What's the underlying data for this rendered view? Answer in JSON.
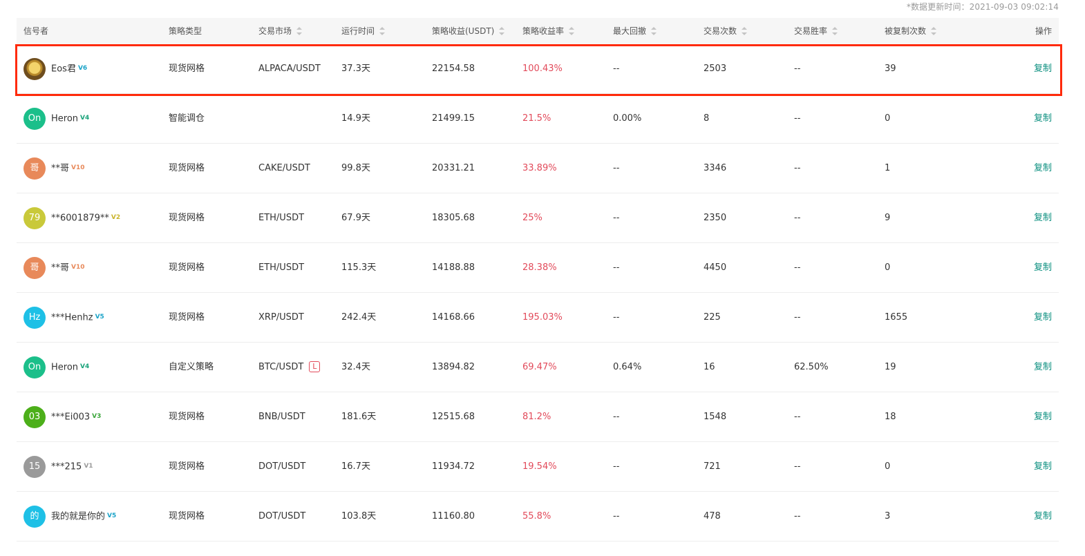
{
  "update_time": "*数据更新时间：2021-09-03 09:02:14",
  "columns": [
    "信号者",
    "策略类型",
    "交易市场",
    "运行时间",
    "策略收益(USDT)",
    "策略收益率",
    "最大回撤",
    "交易次数",
    "交易胜率",
    "被复制次数",
    "操作"
  ],
  "colors": {
    "return": "#e24a5a",
    "copy": "#0b8f7f",
    "highlight": "#ff2a0a"
  },
  "rows": [
    {
      "avatar": "",
      "avatar_color": "#b98a2a",
      "name": "Eos君",
      "badge": "V6",
      "badge_color": "#1aa3c8",
      "type": "现货网格",
      "market": "ALPACA/USDT",
      "leverage": "",
      "runtime": "37.3天",
      "profit": "22154.58",
      "rate": "100.43%",
      "drawdown": "--",
      "trades": "2503",
      "winrate": "--",
      "copied": "39",
      "action": "复制"
    },
    {
      "avatar": "On",
      "avatar_color": "#1bbf8a",
      "name": "Heron",
      "badge": "V4",
      "badge_color": "#1aa37a",
      "type": "智能调仓",
      "market": "",
      "leverage": "",
      "runtime": "14.9天",
      "profit": "21499.15",
      "rate": "21.5%",
      "drawdown": "0.00%",
      "trades": "8",
      "winrate": "--",
      "copied": "0",
      "action": "复制"
    },
    {
      "avatar": "哥",
      "avatar_color": "#e8895a",
      "name": "**哥",
      "badge": "V10",
      "badge_color": "#e8895a",
      "type": "现货网格",
      "market": "CAKE/USDT",
      "leverage": "",
      "runtime": "99.8天",
      "profit": "20331.21",
      "rate": "33.89%",
      "drawdown": "--",
      "trades": "3346",
      "winrate": "--",
      "copied": "1",
      "action": "复制"
    },
    {
      "avatar": "79",
      "avatar_color": "#c9c93a",
      "name": "**6001879**",
      "badge": "V2",
      "badge_color": "#c9b32a",
      "type": "现货网格",
      "market": "ETH/USDT",
      "leverage": "",
      "runtime": "67.9天",
      "profit": "18305.68",
      "rate": "25%",
      "drawdown": "--",
      "trades": "2350",
      "winrate": "--",
      "copied": "9",
      "action": "复制"
    },
    {
      "avatar": "哥",
      "avatar_color": "#e8895a",
      "name": "**哥",
      "badge": "V10",
      "badge_color": "#e8895a",
      "type": "现货网格",
      "market": "ETH/USDT",
      "leverage": "",
      "runtime": "115.3天",
      "profit": "14188.88",
      "rate": "28.38%",
      "drawdown": "--",
      "trades": "4450",
      "winrate": "--",
      "copied": "0",
      "action": "复制"
    },
    {
      "avatar": "Hz",
      "avatar_color": "#1ec0e6",
      "name": "***Henhz",
      "badge": "V5",
      "badge_color": "#1aa3c8",
      "type": "现货网格",
      "market": "XRP/USDT",
      "leverage": "",
      "runtime": "242.4天",
      "profit": "14168.66",
      "rate": "195.03%",
      "drawdown": "--",
      "trades": "225",
      "winrate": "--",
      "copied": "1655",
      "action": "复制"
    },
    {
      "avatar": "On",
      "avatar_color": "#1bbf8a",
      "name": "Heron",
      "badge": "V4",
      "badge_color": "#1aa37a",
      "type": "自定义策略",
      "market": "BTC/USDT",
      "leverage": "L",
      "runtime": "32.4天",
      "profit": "13894.82",
      "rate": "69.47%",
      "drawdown": "0.64%",
      "trades": "16",
      "winrate": "62.50%",
      "copied": "19",
      "action": "复制"
    },
    {
      "avatar": "03",
      "avatar_color": "#4caf1a",
      "name": "***Ei003",
      "badge": "V3",
      "badge_color": "#3aa53a",
      "type": "现货网格",
      "market": "BNB/USDT",
      "leverage": "",
      "runtime": "181.6天",
      "profit": "12515.68",
      "rate": "81.2%",
      "drawdown": "--",
      "trades": "1548",
      "winrate": "--",
      "copied": "18",
      "action": "复制"
    },
    {
      "avatar": "15",
      "avatar_color": "#9a9a9a",
      "name": "***215",
      "badge": "V1",
      "badge_color": "#9a9a9a",
      "type": "现货网格",
      "market": "DOT/USDT",
      "leverage": "",
      "runtime": "16.7天",
      "profit": "11934.72",
      "rate": "19.54%",
      "drawdown": "--",
      "trades": "721",
      "winrate": "--",
      "copied": "0",
      "action": "复制"
    },
    {
      "avatar": "的",
      "avatar_color": "#1ec0e6",
      "name": "我的就是你的",
      "badge": "V5",
      "badge_color": "#1aa3c8",
      "type": "现货网格",
      "market": "DOT/USDT",
      "leverage": "",
      "runtime": "103.8天",
      "profit": "11160.80",
      "rate": "55.8%",
      "drawdown": "--",
      "trades": "478",
      "winrate": "--",
      "copied": "3",
      "action": "复制"
    }
  ]
}
